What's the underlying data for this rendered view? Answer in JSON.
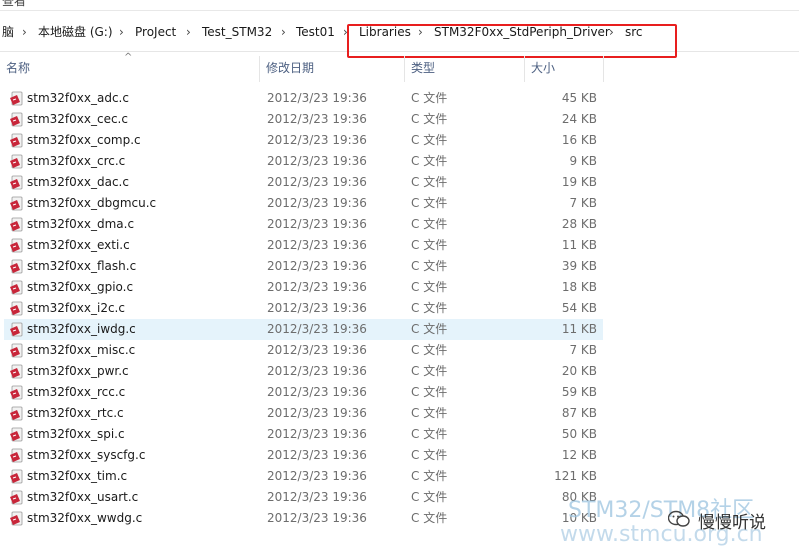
{
  "window": {
    "top_fragment": "查看"
  },
  "address": {
    "crumbs": [
      "脑",
      "本地磁盘 (G:)",
      "ProJect",
      "Test_STM32",
      "Test01",
      "Libraries",
      "STM32F0xx_StdPeriph_Driver",
      "src"
    ],
    "separator": "›",
    "highlight_color": "#e81e1e"
  },
  "columns": {
    "name": "名称",
    "date": "修改日期",
    "type": "类型",
    "size": "大小",
    "sort_indicator": "^"
  },
  "files": [
    {
      "name": "stm32f0xx_adc.c",
      "date": "2012/3/23 19:36",
      "type": "C 文件",
      "size": "45 KB"
    },
    {
      "name": "stm32f0xx_cec.c",
      "date": "2012/3/23 19:36",
      "type": "C 文件",
      "size": "24 KB"
    },
    {
      "name": "stm32f0xx_comp.c",
      "date": "2012/3/23 19:36",
      "type": "C 文件",
      "size": "16 KB"
    },
    {
      "name": "stm32f0xx_crc.c",
      "date": "2012/3/23 19:36",
      "type": "C 文件",
      "size": "9 KB"
    },
    {
      "name": "stm32f0xx_dac.c",
      "date": "2012/3/23 19:36",
      "type": "C 文件",
      "size": "19 KB"
    },
    {
      "name": "stm32f0xx_dbgmcu.c",
      "date": "2012/3/23 19:36",
      "type": "C 文件",
      "size": "7 KB"
    },
    {
      "name": "stm32f0xx_dma.c",
      "date": "2012/3/23 19:36",
      "type": "C 文件",
      "size": "28 KB"
    },
    {
      "name": "stm32f0xx_exti.c",
      "date": "2012/3/23 19:36",
      "type": "C 文件",
      "size": "11 KB"
    },
    {
      "name": "stm32f0xx_flash.c",
      "date": "2012/3/23 19:36",
      "type": "C 文件",
      "size": "39 KB"
    },
    {
      "name": "stm32f0xx_gpio.c",
      "date": "2012/3/23 19:36",
      "type": "C 文件",
      "size": "18 KB"
    },
    {
      "name": "stm32f0xx_i2c.c",
      "date": "2012/3/23 19:36",
      "type": "C 文件",
      "size": "54 KB"
    },
    {
      "name": "stm32f0xx_iwdg.c",
      "date": "2012/3/23 19:36",
      "type": "C 文件",
      "size": "11 KB",
      "selected": true
    },
    {
      "name": "stm32f0xx_misc.c",
      "date": "2012/3/23 19:36",
      "type": "C 文件",
      "size": "7 KB"
    },
    {
      "name": "stm32f0xx_pwr.c",
      "date": "2012/3/23 19:36",
      "type": "C 文件",
      "size": "20 KB"
    },
    {
      "name": "stm32f0xx_rcc.c",
      "date": "2012/3/23 19:36",
      "type": "C 文件",
      "size": "59 KB"
    },
    {
      "name": "stm32f0xx_rtc.c",
      "date": "2012/3/23 19:36",
      "type": "C 文件",
      "size": "87 KB"
    },
    {
      "name": "stm32f0xx_spi.c",
      "date": "2012/3/23 19:36",
      "type": "C 文件",
      "size": "50 KB"
    },
    {
      "name": "stm32f0xx_syscfg.c",
      "date": "2012/3/23 19:36",
      "type": "C 文件",
      "size": "12 KB"
    },
    {
      "name": "stm32f0xx_tim.c",
      "date": "2012/3/23 19:36",
      "type": "C 文件",
      "size": "121 KB"
    },
    {
      "name": "stm32f0xx_usart.c",
      "date": "2012/3/23 19:36",
      "type": "C 文件",
      "size": "80 KB"
    },
    {
      "name": "stm32f0xx_wwdg.c",
      "date": "2012/3/23 19:36",
      "type": "C 文件",
      "size": "10 KB"
    }
  ],
  "file_icon": "c-source-file-icon",
  "watermark": {
    "line1": "STM32/STM8社区",
    "line2": "www.stmcu.org.cn",
    "brand": "慢慢听说"
  },
  "colors": {
    "selected_row": "#e5f3fb",
    "header_text": "#4d6082",
    "meta_text": "#6d6d6d"
  }
}
